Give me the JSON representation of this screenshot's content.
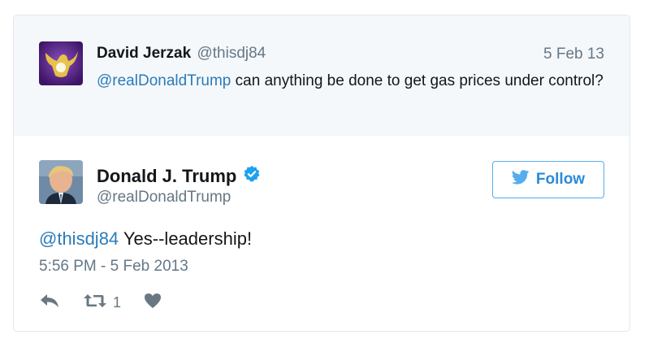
{
  "parent_tweet": {
    "author_name": "David Jerzak",
    "author_handle": "@thisdj84",
    "date": "5 Feb 13",
    "mention": "@realDonaldTrump",
    "text": " can anything be done to get gas prices under control?"
  },
  "tweet": {
    "author_name": "Donald J. Trump",
    "author_handle": "@realDonaldTrump",
    "verified": true,
    "follow_label": "Follow",
    "mention": "@thisdj84",
    "text": " Yes--leadership!",
    "timestamp": "5:56 PM - 5 Feb 2013",
    "retweet_count": "1"
  },
  "icons": {
    "reply": "reply-icon",
    "retweet": "retweet-icon",
    "like": "heart-icon",
    "bird": "twitter-bird-icon",
    "verified": "verified-badge-icon"
  },
  "colors": {
    "link": "#2b7bb9",
    "follow": "#2b8ad8",
    "muted": "#657786",
    "verified": "#1da1f2"
  }
}
